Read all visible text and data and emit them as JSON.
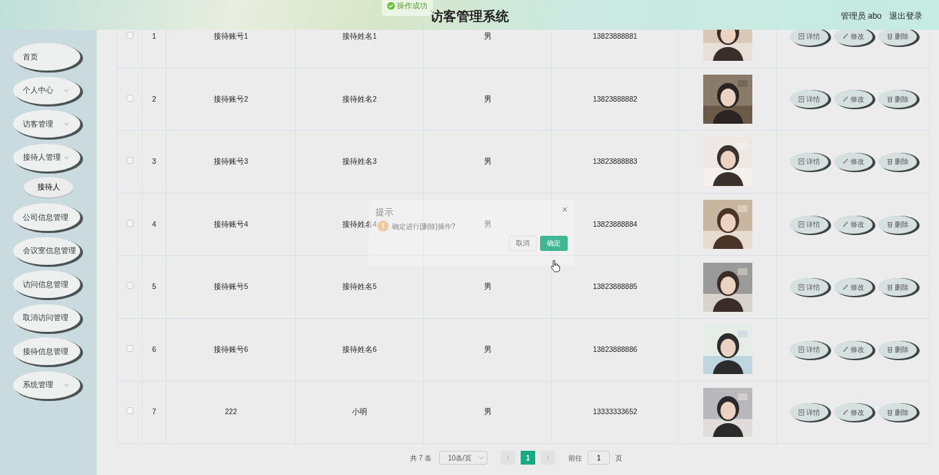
{
  "header": {
    "title": "访客管理系统",
    "user": "管理员 abo",
    "logout": "退出登录"
  },
  "toast": {
    "text": "操作成功"
  },
  "sidebar": {
    "items": [
      {
        "label": "首页",
        "expandable": false
      },
      {
        "label": "个人中心",
        "expandable": true
      },
      {
        "label": "访客管理",
        "expandable": true
      },
      {
        "label": "接待人管理",
        "expandable": true,
        "children": [
          {
            "label": "接待人"
          }
        ]
      },
      {
        "label": "公司信息管理",
        "expandable": false
      },
      {
        "label": "会议室信息管理",
        "expandable": false
      },
      {
        "label": "访问信息管理",
        "expandable": false
      },
      {
        "label": "取消访问管理",
        "expandable": false
      },
      {
        "label": "接待信息管理",
        "expandable": false
      },
      {
        "label": "系统管理",
        "expandable": true
      }
    ]
  },
  "table": {
    "rows": [
      {
        "checked": false,
        "index": "1",
        "account": "接待账号1",
        "name": "接待姓名1",
        "gender": "男",
        "phone": "13823888881",
        "actions": [
          {
            "label": "详情",
            "kind": "detail"
          },
          {
            "label": "修改",
            "kind": "edit"
          },
          {
            "label": "删除",
            "kind": "delete"
          }
        ]
      },
      {
        "checked": false,
        "index": "2",
        "account": "接待账号2",
        "name": "接待姓名2",
        "gender": "男",
        "phone": "13823888882",
        "actions": [
          {
            "label": "详情",
            "kind": "detail"
          },
          {
            "label": "修改",
            "kind": "edit"
          },
          {
            "label": "删除",
            "kind": "delete"
          }
        ]
      },
      {
        "checked": false,
        "index": "3",
        "account": "接待账号3",
        "name": "接待姓名3",
        "gender": "男",
        "phone": "13823888883",
        "actions": [
          {
            "label": "详情",
            "kind": "detail"
          },
          {
            "label": "修改",
            "kind": "edit"
          },
          {
            "label": "删除",
            "kind": "delete"
          }
        ]
      },
      {
        "checked": false,
        "index": "4",
        "account": "接待账号4",
        "name": "接待姓名4",
        "gender": "男",
        "phone": "13823888884",
        "actions": [
          {
            "label": "详情",
            "kind": "detail"
          },
          {
            "label": "修改",
            "kind": "edit"
          },
          {
            "label": "删除",
            "kind": "delete"
          }
        ]
      },
      {
        "checked": false,
        "index": "5",
        "account": "接待账号5",
        "name": "接待姓名5",
        "gender": "男",
        "phone": "13823888885",
        "actions": [
          {
            "label": "详情",
            "kind": "detail"
          },
          {
            "label": "修改",
            "kind": "edit"
          },
          {
            "label": "删除",
            "kind": "delete"
          }
        ]
      },
      {
        "checked": false,
        "index": "6",
        "account": "接待账号6",
        "name": "接待姓名6",
        "gender": "男",
        "phone": "13823888886",
        "actions": [
          {
            "label": "详情",
            "kind": "detail"
          },
          {
            "label": "修改",
            "kind": "edit"
          },
          {
            "label": "删除",
            "kind": "delete"
          }
        ]
      },
      {
        "checked": false,
        "index": "7",
        "account": "222",
        "name": "小明",
        "gender": "男",
        "phone": "13333333652",
        "actions": [
          {
            "label": "详情",
            "kind": "detail"
          },
          {
            "label": "修改",
            "kind": "edit"
          },
          {
            "label": "删除",
            "kind": "delete"
          }
        ]
      }
    ]
  },
  "pagination": {
    "total": "共 7 条",
    "page_size": "10条/页",
    "pages": [
      {
        "label": "1",
        "selected": true
      }
    ],
    "goto_label": "前往",
    "goto_value": "1",
    "goto_suffix": "页"
  },
  "dialog": {
    "title": "提示",
    "close": "×",
    "message": "确定进行[删除]操作?",
    "buttons": [
      {
        "label": "取消",
        "kind": "cancel"
      },
      {
        "label": "确定",
        "kind": "confirm"
      }
    ]
  }
}
